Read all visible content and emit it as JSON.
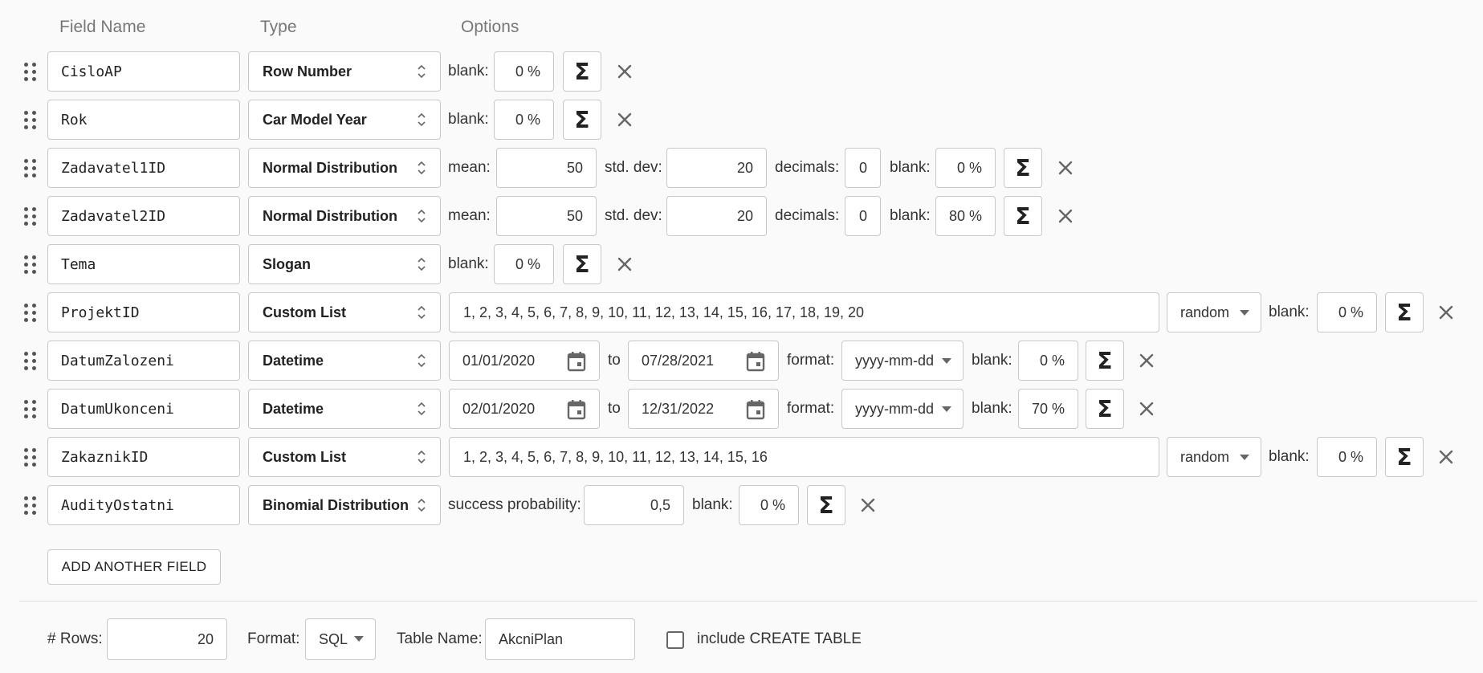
{
  "headers": {
    "field_name": "Field Name",
    "type": "Type",
    "options": "Options"
  },
  "rows": [
    {
      "name": "CisloAP",
      "type": "Row Number",
      "blank": "0 %"
    },
    {
      "name": "Rok",
      "type": "Car Model Year",
      "blank": "0 %"
    },
    {
      "name": "Zadavatel1ID",
      "type": "Normal Distribution",
      "mean": "50",
      "std_dev": "20",
      "decimals": "0",
      "blank": "0 %"
    },
    {
      "name": "Zadavatel2ID",
      "type": "Normal Distribution",
      "mean": "50",
      "std_dev": "20",
      "decimals": "0",
      "blank": "80 %"
    },
    {
      "name": "Tema",
      "type": "Slogan",
      "blank": "0 %"
    },
    {
      "name": "ProjektID",
      "type": "Custom List",
      "values": "1, 2, 3, 4, 5, 6, 7, 8, 9, 10, 11, 12, 13, 14, 15, 16, 17, 18, 19, 20",
      "order": "random",
      "blank": "0 %"
    },
    {
      "name": "DatumZalozeni",
      "type": "Datetime",
      "from": "01/01/2020",
      "to": "07/28/2021",
      "format": "yyyy-mm-dd",
      "blank": "0 %"
    },
    {
      "name": "DatumUkonceni",
      "type": "Datetime",
      "from": "02/01/2020",
      "to": "12/31/2022",
      "format": "yyyy-mm-dd",
      "blank": "70 %"
    },
    {
      "name": "ZakaznikID",
      "type": "Custom List",
      "values": "1, 2, 3, 4, 5, 6, 7, 8, 9, 10, 11, 12, 13, 14, 15, 16",
      "order": "random",
      "blank": "0 %"
    },
    {
      "name": "AudityOstatni",
      "type": "Binomial Distribution",
      "success_probability": "0,5",
      "blank": "0 %"
    }
  ],
  "labels": {
    "blank": "blank:",
    "mean": "mean:",
    "std_dev": "std. dev:",
    "decimals": "decimals:",
    "to": "to",
    "format": "format:",
    "success_probability": "success probability:",
    "sigma": "Σ"
  },
  "add_field_label": "ADD ANOTHER FIELD",
  "footer": {
    "rows_label": "# Rows:",
    "rows_value": "20",
    "format_label": "Format:",
    "format_value": "SQL",
    "table_name_label": "Table Name:",
    "table_name_value": "AkcniPlan",
    "create_table_label": "include CREATE TABLE",
    "create_table_checked": false
  },
  "icons": {
    "drag": "drag-handle-icon",
    "close": "close-icon",
    "calendar": "calendar-icon",
    "sort": "sort-arrows-icon",
    "dropdown": "caret-down-icon"
  }
}
